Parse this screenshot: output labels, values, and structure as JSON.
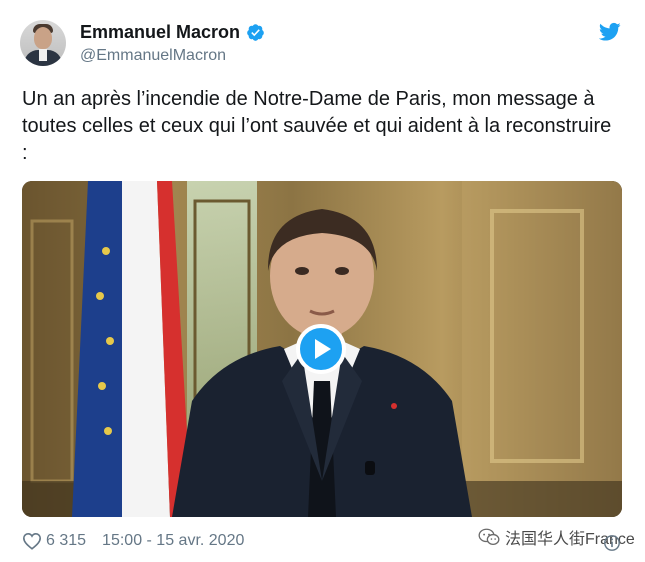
{
  "author": {
    "display_name": "Emmanuel Macron",
    "handle": "@EmmanuelMacron",
    "verified": true
  },
  "tweet": {
    "text": "Un an après l’incendie de Notre-Dame de Paris, mon message à toutes celles et ceux qui l’ont sauvée et qui aident à la reconstruire :"
  },
  "media": {
    "type": "video",
    "play_icon": "play-icon"
  },
  "footer": {
    "likes": "6 315",
    "timestamp": "15:00 - 15 avr. 2020",
    "heart_icon": "heart-icon",
    "info_icon": "info-icon"
  },
  "watermark": {
    "text": "法国华人街France"
  },
  "colors": {
    "twitter_blue": "#1da1f2",
    "secondary_text": "#657786",
    "primary_text": "#14171a"
  }
}
